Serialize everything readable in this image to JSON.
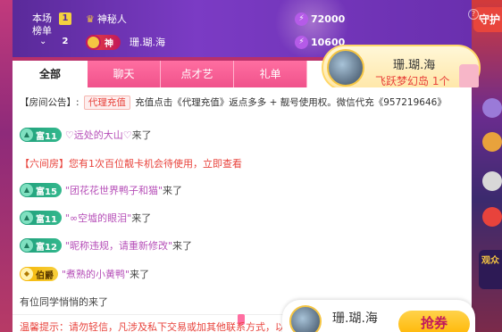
{
  "right_edge": {
    "tab_label": "守护",
    "badge_label": "观众"
  },
  "rank": {
    "label_line1": "本场",
    "label_line2": "榜单",
    "row1": {
      "num": "1",
      "name": "神秘人",
      "score": "72000"
    },
    "row2": {
      "num": "2",
      "badge": "神",
      "name": "珊.瑚.海",
      "score": "10600"
    },
    "help": "?"
  },
  "tabs": [
    "全部",
    "聊天",
    "点才艺",
    "礼单"
  ],
  "host_card": {
    "name": "珊.瑚.海",
    "subtitle": "飞跃梦幻岛 1个"
  },
  "notice": {
    "prefix": "【房间公告】:",
    "tag": "代理充值",
    "text": "充值点击《代理充值》返点多多 + 靓号使用权。微信代充《957219646》"
  },
  "messages": [
    {
      "type": "user",
      "level": "富11",
      "name": "♡远处的大山♡",
      "suffix": "来了"
    },
    {
      "type": "system",
      "text": "【六间房】您有1次百位靓卡机会待使用，立即查看"
    },
    {
      "type": "user",
      "level": "富15",
      "name": "\"团花花世界鸭子和猫\"",
      "suffix": "来了"
    },
    {
      "type": "user",
      "level": "富11",
      "name": "\"∞空墟的眼泪\"",
      "suffix": "来了"
    },
    {
      "type": "user",
      "level": "富12",
      "name": "\"昵称违规，请重新修改\"",
      "suffix": "来了"
    },
    {
      "type": "user_gold",
      "level": "伯爵",
      "name": "\"煮熟的小黄鸭\"",
      "suffix": "来了"
    },
    {
      "type": "plain",
      "text": "有位同学悄悄的来了"
    }
  ],
  "cut_line": "温馨提示：请勿轻信，凡涉及私下交易或加其他联系方式，以免上当受骗",
  "float_card": {
    "name": "珊.瑚.海",
    "button": "抢券"
  },
  "colors": {
    "accent": "#f0528b",
    "brand_purple": "#6a2fae",
    "level_green": "#1f9e7a",
    "gold": "#f5c542"
  }
}
